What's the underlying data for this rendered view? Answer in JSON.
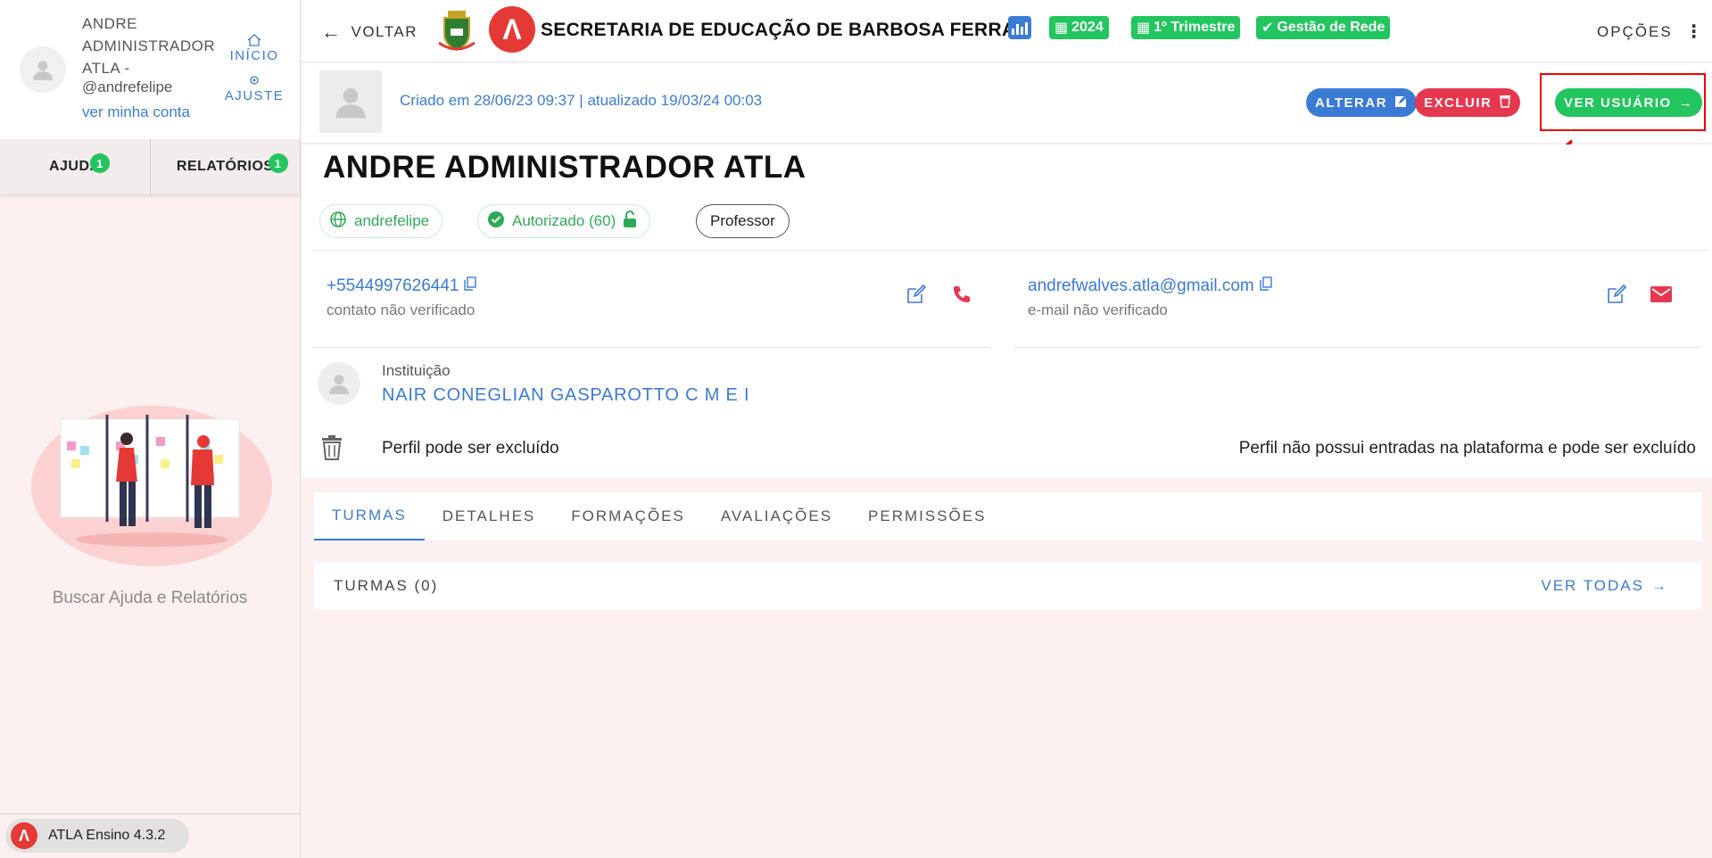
{
  "sidebar": {
    "user_name": "ANDRE ADMINISTRADOR ATLA -",
    "user_handle": "@andrefelipe",
    "my_account": "ver minha conta",
    "link_inicio": "INÍCIO",
    "link_ajuste": "AJUSTE",
    "tabs": [
      {
        "label": "AJUDA",
        "count": "1"
      },
      {
        "label": "RELATÓRIOS",
        "count": "1"
      }
    ],
    "help_caption": "Buscar Ajuda e Relatórios",
    "version": "ATLA Ensino 4.3.2"
  },
  "header": {
    "back_label": "VOLTAR",
    "org_title": "SECRETARIA DE EDUCAÇÃO DE BARBOSA FERRAZ",
    "year": "2024",
    "trimester": "1º Trimestre",
    "network": "Gestão de Rede",
    "options": "OPÇÕES"
  },
  "meta": {
    "created_text": "Criado em 28/06/23 09:37 | atualizado 19/03/24 00:03",
    "alterar": "ALTERAR",
    "excluir": "EXCLUIR",
    "ver_usuario": "VER USUÁRIO"
  },
  "profile": {
    "name": "ANDRE ADMINISTRADOR ATLA",
    "username": "andrefelipe",
    "authorized": "Autorizado (60)",
    "role": "Professor",
    "phone": "+5544997626441",
    "phone_status": "contato não verificado",
    "email": "andrefwalves.atla@gmail.com",
    "email_status": "e-mail não verificado",
    "institution_label": "Instituição",
    "institution_name": "NAIR CONEGLIAN GASPAROTTO C M E I",
    "delete_left": "Perfil pode ser excluído",
    "delete_right": "Perfil não possui entradas na plataforma e pode ser excluído"
  },
  "tabs": [
    "TURMAS",
    "DETALHES",
    "FORMAÇÕES",
    "AVALIAÇÕES",
    "PERMISSÕES"
  ],
  "turmas": {
    "title": "TURMAS (0)",
    "see_all": "VER TODAS"
  },
  "colors": {
    "accent_blue": "#3a7bd5",
    "success_green": "#22c55e",
    "danger_red": "#e5384f",
    "brand_red": "#e53935",
    "background": "#fdf0f0"
  }
}
